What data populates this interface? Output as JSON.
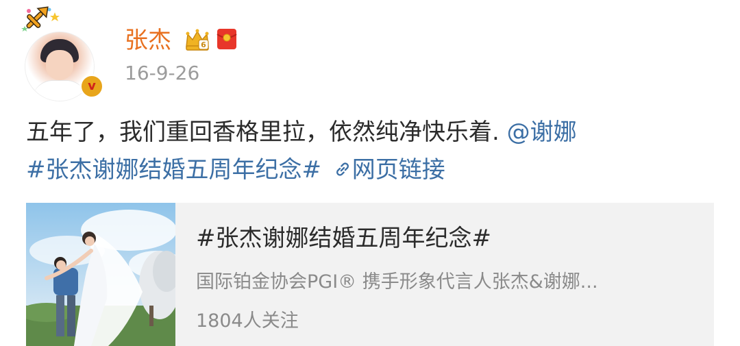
{
  "user": {
    "name": "张杰",
    "time": "16-9-26",
    "verified_glyph": "v",
    "icons": [
      "sagittarius-icon",
      "crown-icon",
      "red-packet-icon",
      "verified-badge"
    ]
  },
  "post": {
    "text": "五年了，我们重回香格里拉，依然纯净快乐着. ",
    "mention": "@谢娜",
    "hashtag": "#张杰谢娜结婚五周年纪念#",
    "link_label": "网页链接"
  },
  "card": {
    "title": "#张杰谢娜结婚五周年纪念#",
    "description": "国际铂金协会PGI® 携手形象代言人张杰&谢娜...",
    "stat": "1804人关注"
  },
  "colors": {
    "username": "#e8701f",
    "link": "#3c6fa5",
    "text": "#2b2b2b",
    "meta": "#9b9b9b",
    "card_bg": "#f2f2f2",
    "badge": "#e8a51b"
  }
}
